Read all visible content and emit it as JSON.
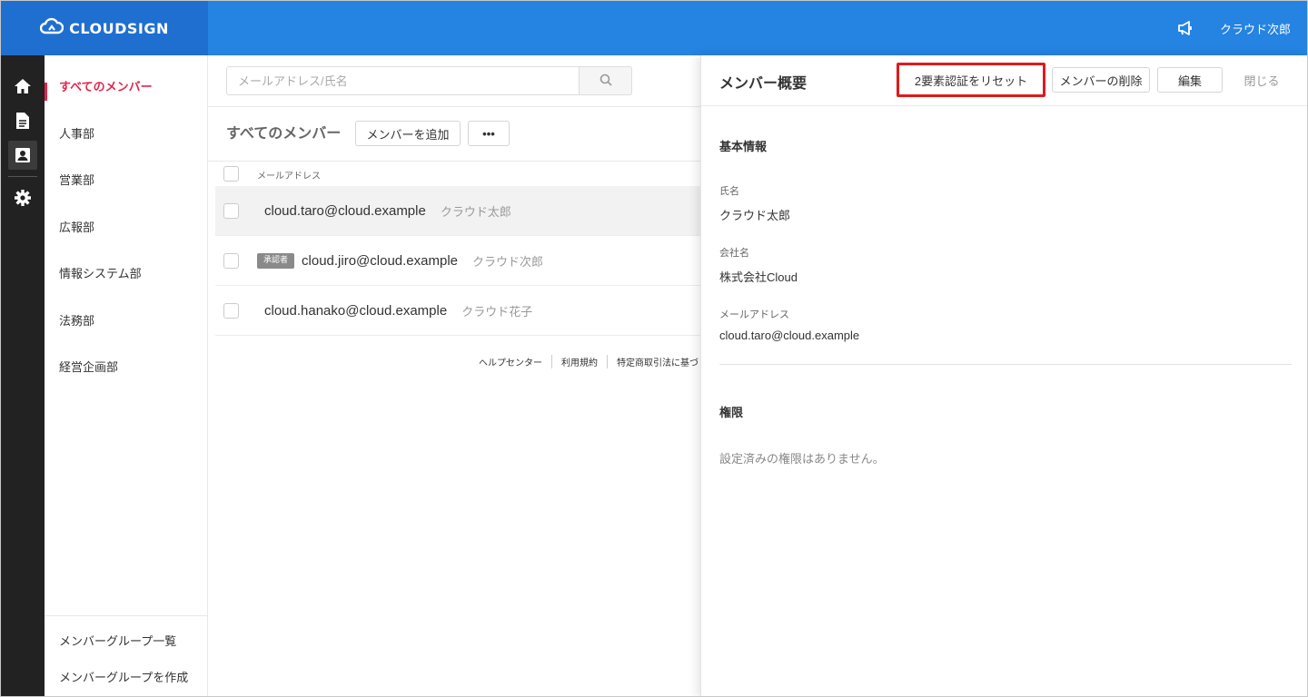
{
  "header": {
    "logo_text": "CLOUDSIGN",
    "user_name": "クラウド次郎"
  },
  "rail": {
    "icons": [
      "home-icon",
      "document-icon",
      "contacts-icon",
      "gear-icon"
    ],
    "active": "contacts-icon"
  },
  "groups": {
    "items": [
      {
        "label": "すべてのメンバー",
        "active": true
      },
      {
        "label": "人事部",
        "active": false
      },
      {
        "label": "営業部",
        "active": false
      },
      {
        "label": "広報部",
        "active": false
      },
      {
        "label": "情報システム部",
        "active": false
      },
      {
        "label": "法務部",
        "active": false
      },
      {
        "label": "経営企画部",
        "active": false
      }
    ],
    "bottom_links": [
      "メンバーグループ一覧",
      "メンバーグループを作成"
    ]
  },
  "list": {
    "search_placeholder": "メールアドレス/氏名",
    "title": "すべてのメンバー",
    "add_button": "メンバーを追加",
    "more_button": "•••",
    "column_email": "メールアドレス",
    "rows": [
      {
        "email": "cloud.taro@cloud.example",
        "name": "クラウド太郎",
        "badge": "",
        "selected": true
      },
      {
        "email": "cloud.jiro@cloud.example",
        "name": "クラウド次郎",
        "badge": "承認者",
        "selected": false
      },
      {
        "email": "cloud.hanako@cloud.example",
        "name": "クラウド花子",
        "badge": "",
        "selected": false
      }
    ],
    "footer_links": [
      "ヘルプセンター",
      "利用規約",
      "特定商取引法に基づく表"
    ]
  },
  "panel": {
    "title": "メンバー概要",
    "reset_2fa_button": "2要素認証をリセット",
    "delete_button": "メンバーの削除",
    "edit_button": "編集",
    "close_button": "閉じる",
    "basic_info_title": "基本情報",
    "name_label": "氏名",
    "name_value": "クラウド太郎",
    "company_label": "会社名",
    "company_value": "株式会社Cloud",
    "email_label": "メールアドレス",
    "email_value": "cloud.taro@cloud.example",
    "permissions_title": "権限",
    "permissions_empty": "設定済みの権限はありません。"
  },
  "colors": {
    "header_blue": "#2583e2",
    "logo_blue": "#1f6fd0",
    "active_red": "#e3264c",
    "highlight_red": "#e01a1a",
    "rail_dark": "#222222"
  }
}
